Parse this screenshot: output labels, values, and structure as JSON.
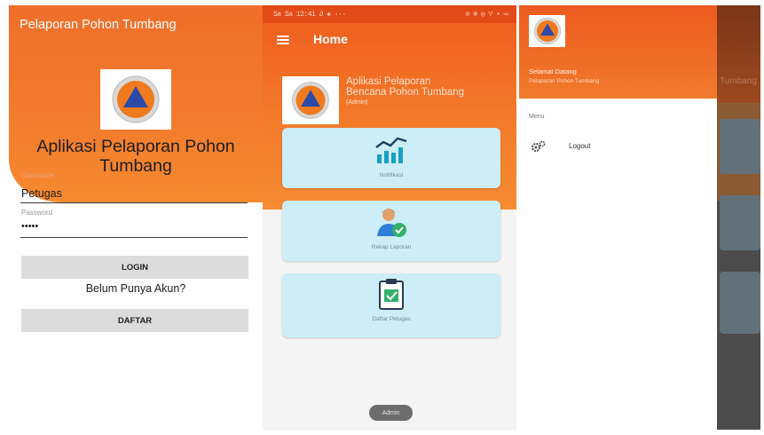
{
  "login": {
    "title": "Pelaporan Pohon Tumbang",
    "app_title_line1": "Aplikasi Pelaporan Pohon",
    "app_title_line2": "Tumbang",
    "username_label": "Username",
    "username_value": "Petugas",
    "password_label": "Password",
    "password_value": "•••••",
    "login_button": "LOGIN",
    "no_account_text": "Belum Punya Akun?",
    "register_button": "DAFTAR",
    "accent": "#f27b2d"
  },
  "home": {
    "status_left": "Sa Sa 12:41 ∂ ◈ ···",
    "status_right": "⊙ ⊗ ◎ ▽ • ▭",
    "header_title": "Home",
    "app_title_line1": "Aplikasi Pelaporan",
    "app_title_line2": "Bencana Pohon Tumbang",
    "role": "(Admin)",
    "cards": [
      {
        "label": "Notifikasi",
        "icon": "chart-icon"
      },
      {
        "label": "Rekap Laporan",
        "icon": "user-check-icon"
      },
      {
        "label": "Daftar Petugas",
        "icon": "clipboard-check-icon"
      }
    ],
    "bottom_pill": "Admin",
    "card_color": "#cdeef6"
  },
  "drawer": {
    "welcome": "Selamat Datang",
    "subtitle": "Pelaporan Pohon Tumbang",
    "menu_label": "Menu",
    "items": [
      {
        "label": "Logout",
        "icon": "logout-gears-icon"
      }
    ],
    "background_hint": "Tumbang"
  }
}
